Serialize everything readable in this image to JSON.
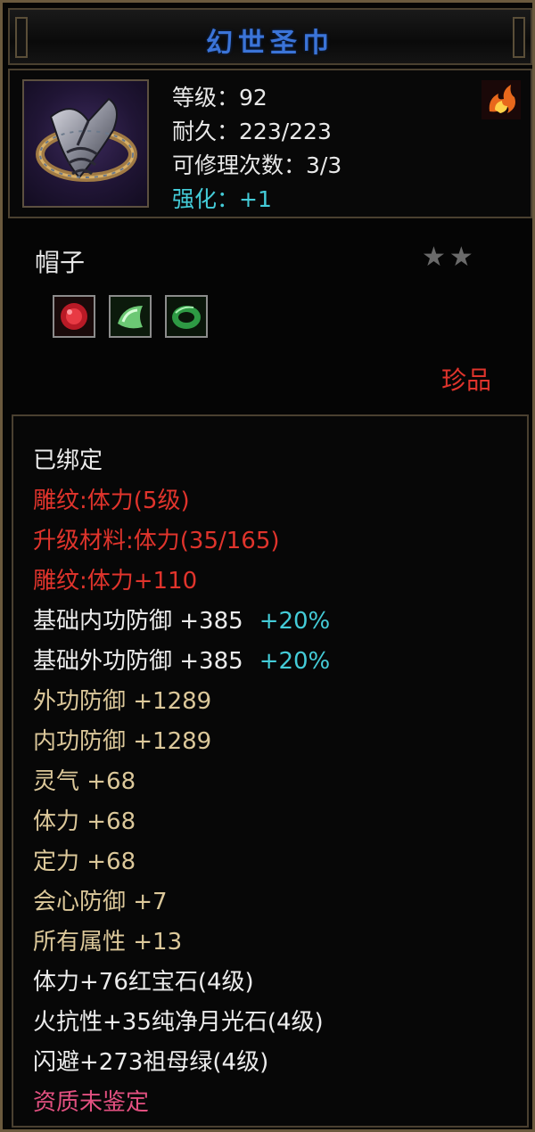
{
  "title": "幻世圣巾",
  "header": {
    "icon_name": "helmet-icon",
    "level_label": "等级：",
    "level_value": "92",
    "durability_label": "耐久：",
    "durability_value": "223/223",
    "repair_label": "可修理次数：",
    "repair_value": "3/3",
    "enhance_label": "强化：",
    "enhance_value": "+1",
    "badge_icon": "flame-icon"
  },
  "item_type": "帽子",
  "stars": {
    "filled": 2,
    "glyph": "★★"
  },
  "gems": [
    {
      "icon": "ruby-gem-icon",
      "color": "#c8202c"
    },
    {
      "icon": "moonstone-gem-icon",
      "color": "#5fc06a"
    },
    {
      "icon": "emerald-gem-icon",
      "color": "#2e9a44"
    }
  ],
  "rarity": "珍品",
  "attributes": [
    {
      "text": "已绑定",
      "extra": "",
      "color": "white"
    },
    {
      "text": "雕纹:体力(5级)",
      "extra": "",
      "color": "red"
    },
    {
      "text": "升级材料:体力(35/165)",
      "extra": "",
      "color": "red"
    },
    {
      "text": "雕纹:体力+110",
      "extra": "",
      "color": "red"
    },
    {
      "text": "基础内功防御  +385",
      "extra": "+20%",
      "color": "white"
    },
    {
      "text": "基础外功防御  +385",
      "extra": "+20%",
      "color": "white"
    },
    {
      "text": "外功防御  +1289",
      "extra": "",
      "color": "gold"
    },
    {
      "text": "内功防御  +1289",
      "extra": "",
      "color": "gold"
    },
    {
      "text": "灵气  +68",
      "extra": "",
      "color": "gold"
    },
    {
      "text": "体力  +68",
      "extra": "",
      "color": "gold"
    },
    {
      "text": "定力  +68",
      "extra": "",
      "color": "gold"
    },
    {
      "text": "会心防御  +7",
      "extra": "",
      "color": "gold"
    },
    {
      "text": "所有属性  +13",
      "extra": "",
      "color": "gold"
    },
    {
      "text": "体力+76红宝石(4级)",
      "extra": "",
      "color": "white"
    },
    {
      "text": "火抗性+35纯净月光石(4级)",
      "extra": "",
      "color": "white"
    },
    {
      "text": "闪避+273祖母绿(4级)",
      "extra": "",
      "color": "white"
    },
    {
      "text": "资质未鉴定",
      "extra": "",
      "color": "pink"
    }
  ],
  "colors": {
    "title": "#3b74d8",
    "white": "#ececec",
    "red": "#e0342c",
    "gold": "#dcc89a",
    "cyan": "#44ccd8",
    "pink": "#e25080",
    "border": "#6b5a3e"
  }
}
